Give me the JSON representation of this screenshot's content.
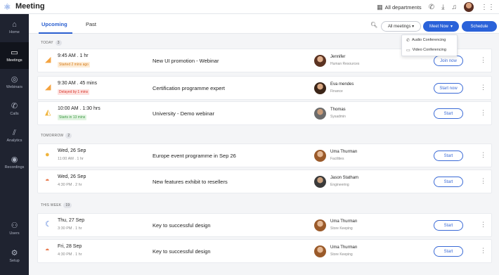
{
  "app": {
    "title": "Meeting"
  },
  "topbar": {
    "department": "All departments"
  },
  "sidebar": {
    "items": [
      {
        "label": "Home",
        "icon": "home-icon",
        "glyph": "⌂"
      },
      {
        "label": "Meetings",
        "icon": "monitor-icon",
        "glyph": "▭"
      },
      {
        "label": "Webinars",
        "icon": "webinar-icon",
        "glyph": "◎"
      },
      {
        "label": "Calls",
        "icon": "phone-icon",
        "glyph": "✆"
      },
      {
        "label": "Analytics",
        "icon": "analytics-icon",
        "glyph": "⫽"
      },
      {
        "label": "Recordings",
        "icon": "record-icon",
        "glyph": "◉"
      },
      {
        "label": "Users",
        "icon": "users-icon",
        "glyph": "⚇"
      },
      {
        "label": "Setup",
        "icon": "settings-icon",
        "glyph": "⚙"
      }
    ]
  },
  "tabs": {
    "upcoming": "Upcoming",
    "past": "Past"
  },
  "toolbar": {
    "all_meetings": "All meetings ▾",
    "meet_now": "Meet Now",
    "schedule": "Schedule"
  },
  "dropdown": {
    "audio": "Audio Conferencing",
    "video": "Video Conferencing"
  },
  "sections": {
    "today": {
      "label": "TODAY",
      "count": "3"
    },
    "tomorrow": {
      "label": "TOMORROW",
      "count": "2"
    },
    "this_week": {
      "label": "THIS WEEK",
      "count": "19"
    }
  },
  "meetings": [
    {
      "time": "9:45 AM . 1 hr",
      "status": "Started 2 mins ago",
      "title": "New UI promotion - Webinar",
      "person": "Jennifer",
      "dept": "Human Resources",
      "action": "Join now"
    },
    {
      "time": "9:30 AM . 45 mins",
      "status": "Delayed by 1 mins",
      "title": "Certification programme expert",
      "person": "Eva mendes",
      "dept": "Finance",
      "action": "Start now"
    },
    {
      "time": "10:00 AM . 1:30 hrs",
      "status": "Starts in 13 mins",
      "title": "University - Demo webinar",
      "person": "Thomas",
      "dept": "Sysadmin",
      "action": "Start"
    },
    {
      "time": "Wed, 26 Sep",
      "sub": "11:00 AM . 1 hr",
      "title": "Europe event programme in Sep 26",
      "person": "Uma Thurman",
      "dept": "Facilities",
      "action": "Start"
    },
    {
      "time": "Wed, 26 Sep",
      "sub": "4:30 PM . 2 hr",
      "title": "New features exhibit to resellers",
      "person": "Jason Statham",
      "dept": "Engineering",
      "action": "Start"
    },
    {
      "time": "Thu, 27 Sep",
      "sub": "3:30 PM . 1 hr",
      "title": "Key to successful design",
      "person": "Uma Thurman",
      "dept": "Store Keeping",
      "action": "Start"
    },
    {
      "time": "Fri, 28 Sep",
      "sub": "4:30 PM . 1 hr",
      "title": "Key to successful design",
      "person": "Uma Thurman",
      "dept": "Store Keeping",
      "action": "Start"
    }
  ],
  "colors": {
    "accent": "#2a62d9",
    "sidebar": "#1f2330",
    "started": "#f4a340",
    "delayed": "#e0453c",
    "starts": "#4caf50"
  }
}
